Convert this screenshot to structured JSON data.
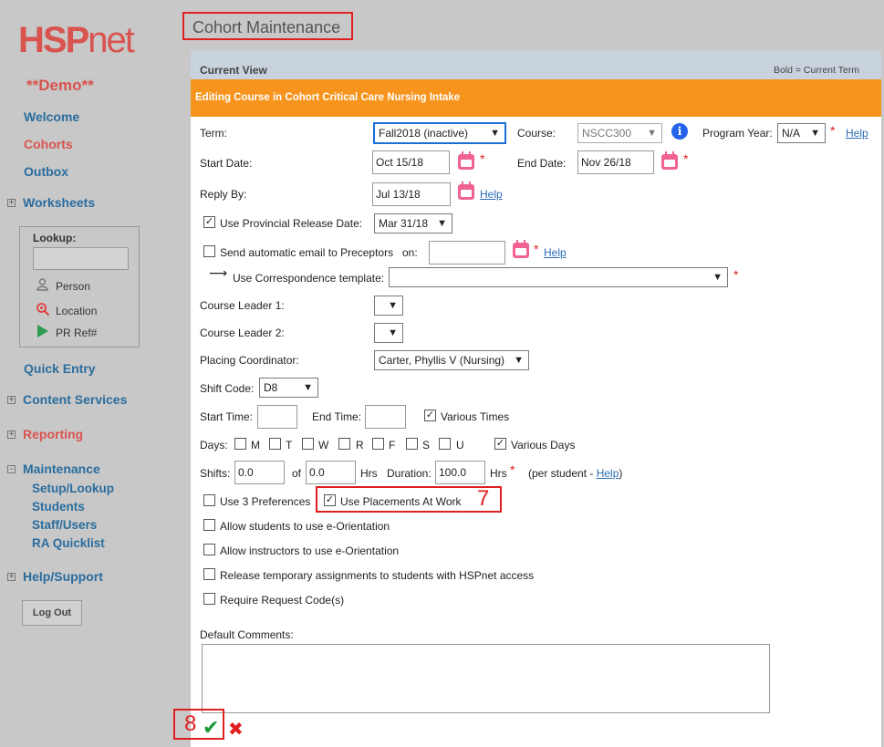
{
  "brand": {
    "logo_bold": "HSP",
    "logo_rest": "net",
    "demo": "**Demo**"
  },
  "sidebar": {
    "nav": [
      "Welcome",
      "Cohorts",
      "Outbox",
      "Worksheets",
      "Quick Entry",
      "Content Services",
      "Reporting",
      "Maintenance",
      "Help/Support"
    ],
    "maintenance_sub": [
      "Setup/Lookup",
      "Students",
      "Staff/Users",
      "RA Quicklist"
    ],
    "lookup": {
      "title": "Lookup:",
      "items": [
        "Person",
        "Location",
        "PR Ref#"
      ]
    },
    "logout": "Log Out",
    "expand_symbol": "+",
    "collapse_symbol": "-"
  },
  "page_title": "Cohort Maintenance",
  "current_view": {
    "title": "Current View",
    "note": "Bold = Current Term"
  },
  "editing_banner": "Editing Course in Cohort Critical Care Nursing Intake",
  "form": {
    "term_label": "Term:",
    "term_value": "Fall2018 (inactive)",
    "course_label": "Course:",
    "course_value": "NSCC300",
    "program_year_label": "Program Year:",
    "program_year_value": "N/A",
    "help": "Help",
    "start_date_label": "Start Date:",
    "start_date_value": "Oct 15/18",
    "end_date_label": "End Date:",
    "end_date_value": "Nov 26/18",
    "reply_by_label": "Reply By:",
    "reply_by_value": "Jul 13/18",
    "provincial_label": "Use Provincial Release Date:",
    "provincial_value": "Mar 31/18",
    "send_email_label": "Send automatic email to Preceptors",
    "on_label": "on:",
    "correspondence_label": "Use Correspondence template:",
    "course_leader1_label": "Course Leader 1:",
    "course_leader2_label": "Course Leader 2:",
    "placing_coord_label": "Placing Coordinator:",
    "placing_coord_value": "Carter, Phyllis V (Nursing)",
    "shift_code_label": "Shift Code:",
    "shift_code_value": "D8",
    "start_time_label": "Start Time:",
    "end_time_label": "End Time:",
    "various_times": "Various Times",
    "days_label": "Days:",
    "days": [
      "M",
      "T",
      "W",
      "R",
      "F",
      "S",
      "U"
    ],
    "various_days": "Various Days",
    "shifts_label": "Shifts:",
    "shifts_value": "0.0",
    "of_label": "of",
    "of_value": "0.0",
    "hrs_label": "Hrs",
    "duration_label": "Duration:",
    "duration_value": "100.0",
    "per_student_prefix": "(per student - ",
    "per_student_suffix": ")",
    "use3_label": "Use 3 Preferences",
    "placements_work_label": "Use Placements At Work",
    "allow_students": "Allow students to use e-Orientation",
    "allow_instructors": "Allow instructors to use e-Orientation",
    "release_temp": "Release temporary assignments to students with HSPnet access",
    "require_code": "Require Request Code(s)",
    "default_comments_label": "Default Comments:",
    "required_mark": "*",
    "check_mark": "✓",
    "dropdown_arrow": "▼",
    "info_symbol": "i",
    "arrow_symbol": "⟶"
  },
  "annotations": {
    "n7": "7",
    "n8": "8"
  },
  "actions": {
    "save_symbol": "✔",
    "cancel_symbol": "✖"
  },
  "colors": {
    "accent": "#f7941d",
    "brand": "#d9534f",
    "link": "#2a6d9e",
    "highlight": "#e02020"
  }
}
